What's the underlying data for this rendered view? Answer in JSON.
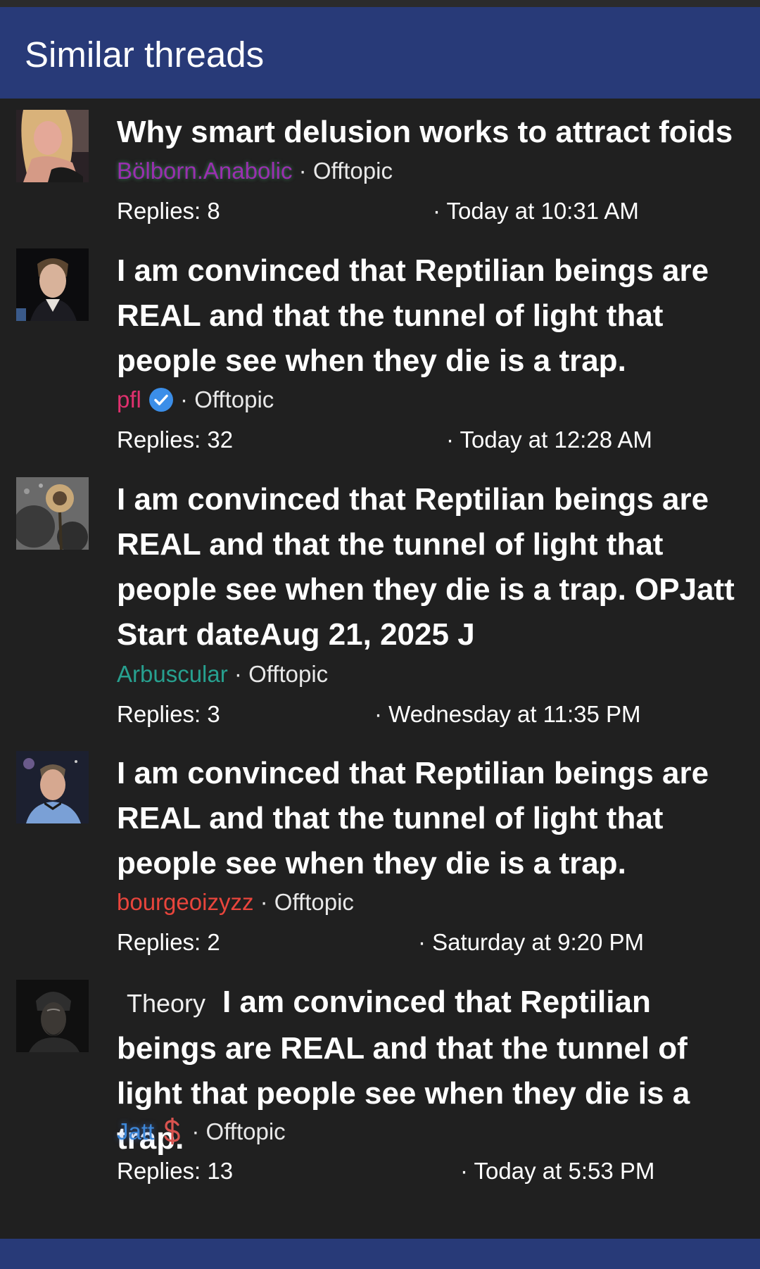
{
  "header": {
    "title": "Similar threads"
  },
  "colors": {
    "header_bg": "#283a78",
    "page_bg": "#202020",
    "user_purple": "#9a2fb0",
    "user_pink": "#e0306e",
    "user_teal": "#27a08f",
    "user_red": "#e8453c",
    "user_blue": "#3d87d8",
    "verified_blue": "#3b8ee8"
  },
  "threads": [
    {
      "avatar_icon": "blonde-woman-avatar",
      "title": "Why smart delusion works to attract foids",
      "user": "Bölborn.Anabolic",
      "forum": "· Offtopic",
      "replies": "Replies: 8",
      "date": "· Today at 10:31 AM"
    },
    {
      "avatar_icon": "man-portrait-avatar",
      "title": "I am convinced that Reptilian beings are REAL and that the tunnel of light that people see when they die is a trap.",
      "user": "pfl",
      "badge_icon": "verified-check-icon",
      "forum": "· Offtopic",
      "replies": "Replies: 32",
      "date": "· Today at 12:28 AM"
    },
    {
      "avatar_icon": "sunflower-art-avatar",
      "title": "I am convinced that Reptilian beings are REAL and that the tunnel of light that people see when they die is a trap. OPJatt Start dateAug 21, 2025 J",
      "user": "Arbuscular",
      "forum": "· Offtopic",
      "replies": "Replies: 3",
      "date": "· Wednesday at 11:35 PM"
    },
    {
      "avatar_icon": "space-officer-avatar",
      "title": "I am convinced that Reptilian beings are REAL and that the tunnel of light that people see when they die is a trap.",
      "user": "bourgeoizyzz",
      "forum": "· Offtopic",
      "replies": "Replies: 2",
      "date": "· Saturday at 9:20 PM"
    },
    {
      "avatar_icon": "dark-turban-figure-avatar",
      "prefix": "Theory",
      "title": "I am convinced that Reptilian beings are REAL and that the tunnel of light that people see when they die is a trap.",
      "user": "Jatt",
      "badge_icon": "dollar-sign-icon",
      "forum": "· Offtopic",
      "replies": "Replies: 13",
      "date": "· Today at 5:53 PM"
    }
  ]
}
